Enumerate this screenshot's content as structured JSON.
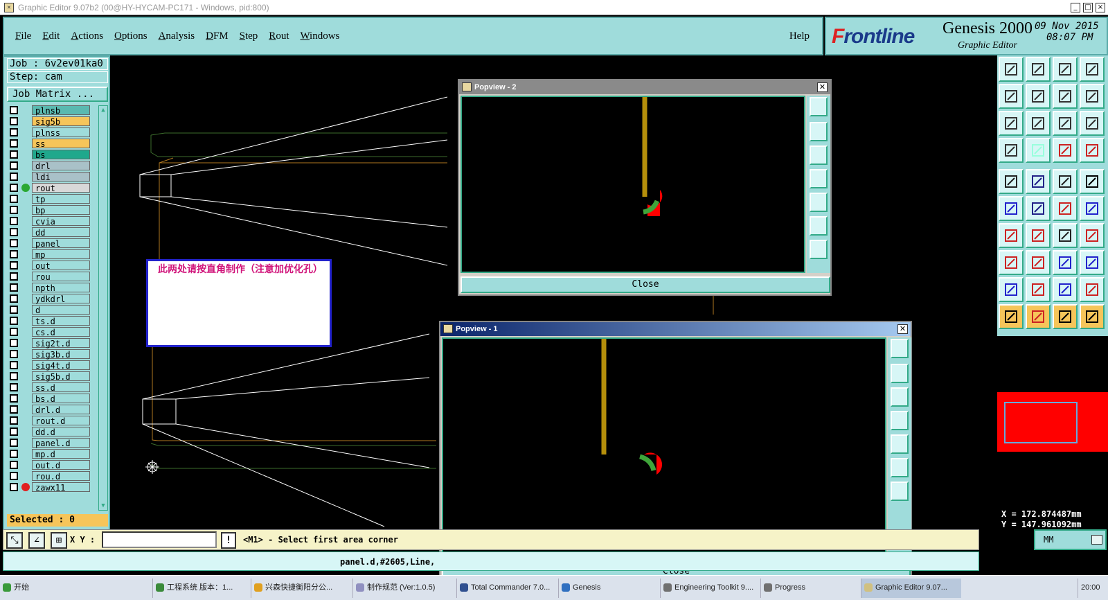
{
  "window": {
    "title": "Graphic Editor 9.07b2 (00@HY-HYCAM-PC171 - Windows, pid:800)",
    "controls": [
      "_",
      "□",
      "×"
    ]
  },
  "menu": {
    "items": [
      "File",
      "Edit",
      "Actions",
      "Options",
      "Analysis",
      "DFM",
      "Step",
      "Rout",
      "Windows"
    ],
    "help": "Help"
  },
  "brand": {
    "logo_prefix": "F",
    "logo_rest": "rontline",
    "product": "Genesis 2000",
    "subtitle": "Graphic Editor",
    "date": "09 Nov 2015",
    "time": "08:07 PM"
  },
  "job": {
    "job_line": "Job : 6v2ev01ka0",
    "step_line": "Step: cam",
    "matrix_button": "Job Matrix ..."
  },
  "layers": [
    {
      "name": "plnsb",
      "bg": "#5ab9b0",
      "dot": ""
    },
    {
      "name": "sig5b",
      "bg": "#f6c55a",
      "dot": ""
    },
    {
      "name": "plnss",
      "bg": "#9fdcdb",
      "dot": ""
    },
    {
      "name": "ss",
      "bg": "#f6c55a",
      "dot": ""
    },
    {
      "name": "bs",
      "bg": "#1fa88c",
      "dot": ""
    },
    {
      "name": "drl",
      "bg": "#a9c1c8",
      "dot": ""
    },
    {
      "name": "ldi",
      "bg": "#a9c1c8",
      "dot": ""
    },
    {
      "name": "rout",
      "bg": "#d8d8d8",
      "dot": "#2aa832"
    },
    {
      "name": "tp",
      "bg": "#9fdcdb",
      "dot": ""
    },
    {
      "name": "bp",
      "bg": "#9fdcdb",
      "dot": ""
    },
    {
      "name": "cvia",
      "bg": "#9fdcdb",
      "dot": ""
    },
    {
      "name": "dd",
      "bg": "#9fdcdb",
      "dot": ""
    },
    {
      "name": "panel",
      "bg": "#9fdcdb",
      "dot": ""
    },
    {
      "name": "mp",
      "bg": "#9fdcdb",
      "dot": ""
    },
    {
      "name": "out",
      "bg": "#9fdcdb",
      "dot": ""
    },
    {
      "name": "rou",
      "bg": "#9fdcdb",
      "dot": ""
    },
    {
      "name": "npth",
      "bg": "#9fdcdb",
      "dot": ""
    },
    {
      "name": "ydkdrl",
      "bg": "#9fdcdb",
      "dot": ""
    },
    {
      "name": "d",
      "bg": "#9fdcdb",
      "dot": ""
    },
    {
      "name": "ts.d",
      "bg": "#9fdcdb",
      "dot": ""
    },
    {
      "name": "cs.d",
      "bg": "#9fdcdb",
      "dot": ""
    },
    {
      "name": "sig2t.d",
      "bg": "#9fdcdb",
      "dot": ""
    },
    {
      "name": "sig3b.d",
      "bg": "#9fdcdb",
      "dot": ""
    },
    {
      "name": "sig4t.d",
      "bg": "#9fdcdb",
      "dot": ""
    },
    {
      "name": "sig5b.d",
      "bg": "#9fdcdb",
      "dot": ""
    },
    {
      "name": "ss.d",
      "bg": "#9fdcdb",
      "dot": ""
    },
    {
      "name": "bs.d",
      "bg": "#9fdcdb",
      "dot": ""
    },
    {
      "name": "drl.d",
      "bg": "#9fdcdb",
      "dot": ""
    },
    {
      "name": "rout.d",
      "bg": "#9fdcdb",
      "dot": ""
    },
    {
      "name": "dd.d",
      "bg": "#9fdcdb",
      "dot": ""
    },
    {
      "name": "panel.d",
      "bg": "#9fdcdb",
      "dot": ""
    },
    {
      "name": "mp.d",
      "bg": "#9fdcdb",
      "dot": ""
    },
    {
      "name": "out.d",
      "bg": "#9fdcdb",
      "dot": ""
    },
    {
      "name": "rou.d",
      "bg": "#9fdcdb",
      "dot": ""
    },
    {
      "name": "zawx11",
      "bg": "#9fdcdb",
      "dot": "#e02020"
    }
  ],
  "selected_text": "Selected : 0",
  "bottom": {
    "xy_label": "X Y :",
    "input_value": "",
    "excl": "!",
    "prompt": "<M1> - Select first area corner",
    "status": "panel.d,#2605,Line,",
    "units": "MM"
  },
  "coords": {
    "x": "X  =  172.874487mm",
    "y": "Y  =  147.961092mm"
  },
  "note": {
    "text": "此两处请按直角制作（注意加优化孔）"
  },
  "popview2": {
    "title": "Popview - 2",
    "close_label": "Close"
  },
  "popview1": {
    "title": "Popview - 1",
    "close_label": "Close"
  },
  "taskbar": {
    "start": "开始",
    "items": [
      "工程系统  版本：1...",
      "兴森快捷衡阳分公...",
      "制作规范 (Ver:1.0.5)",
      "Total Commander 7.0...",
      "Genesis",
      "Engineering Toolkit 9....",
      "Progress",
      "Graphic Editor 9.07..."
    ],
    "clock": "20:00"
  },
  "colors": {
    "panel": "#9fdcdb",
    "trace": "#b58f0b",
    "highlight_red": "#ff0000",
    "highlight_green": "#3fa43a",
    "note_text": "#d0137a",
    "note_border": "#2222cc"
  }
}
